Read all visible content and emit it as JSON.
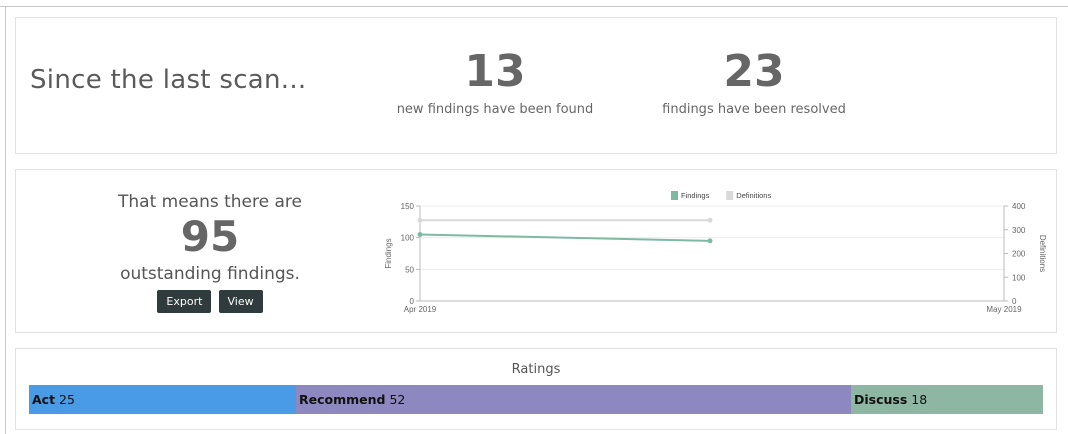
{
  "since": {
    "lead": "Since the last scan...",
    "new_count": "13",
    "new_caption": "new findings have been found",
    "resolved_count": "23",
    "resolved_caption": "findings have been resolved"
  },
  "summary": {
    "pre": "That means there are",
    "count": "95",
    "post": "outstanding findings.",
    "export_label": "Export",
    "view_label": "View"
  },
  "chart_data": {
    "type": "line",
    "x": [
      "Apr 2019",
      "May 2019"
    ],
    "x_tick_labels": [
      "Apr 2019",
      "May 2019"
    ],
    "series": [
      {
        "name": "Findings",
        "axis": "left",
        "color": "#7fb9a4",
        "values": [
          105,
          95
        ]
      },
      {
        "name": "Definitions",
        "axis": "right",
        "color": "#d9d9d9",
        "values": [
          340,
          340
        ]
      }
    ],
    "ylabel": "Findings",
    "y2label": "Definitions",
    "ylim": [
      0,
      150
    ],
    "y2lim": [
      0,
      400
    ],
    "yticks": [
      0,
      50,
      100,
      150
    ],
    "y2ticks": [
      0,
      100,
      200,
      300,
      400
    ],
    "legend": "top-center",
    "grid": true
  },
  "ratings": {
    "title": "Ratings",
    "segments": [
      {
        "label": "Act",
        "value": "25",
        "count": 25,
        "color": "#4a9be5"
      },
      {
        "label": "Recommend",
        "value": "52",
        "count": 52,
        "color": "#8d88bf"
      },
      {
        "label": "Discuss",
        "value": "18",
        "count": 18,
        "color": "#8db7a3"
      }
    ]
  }
}
